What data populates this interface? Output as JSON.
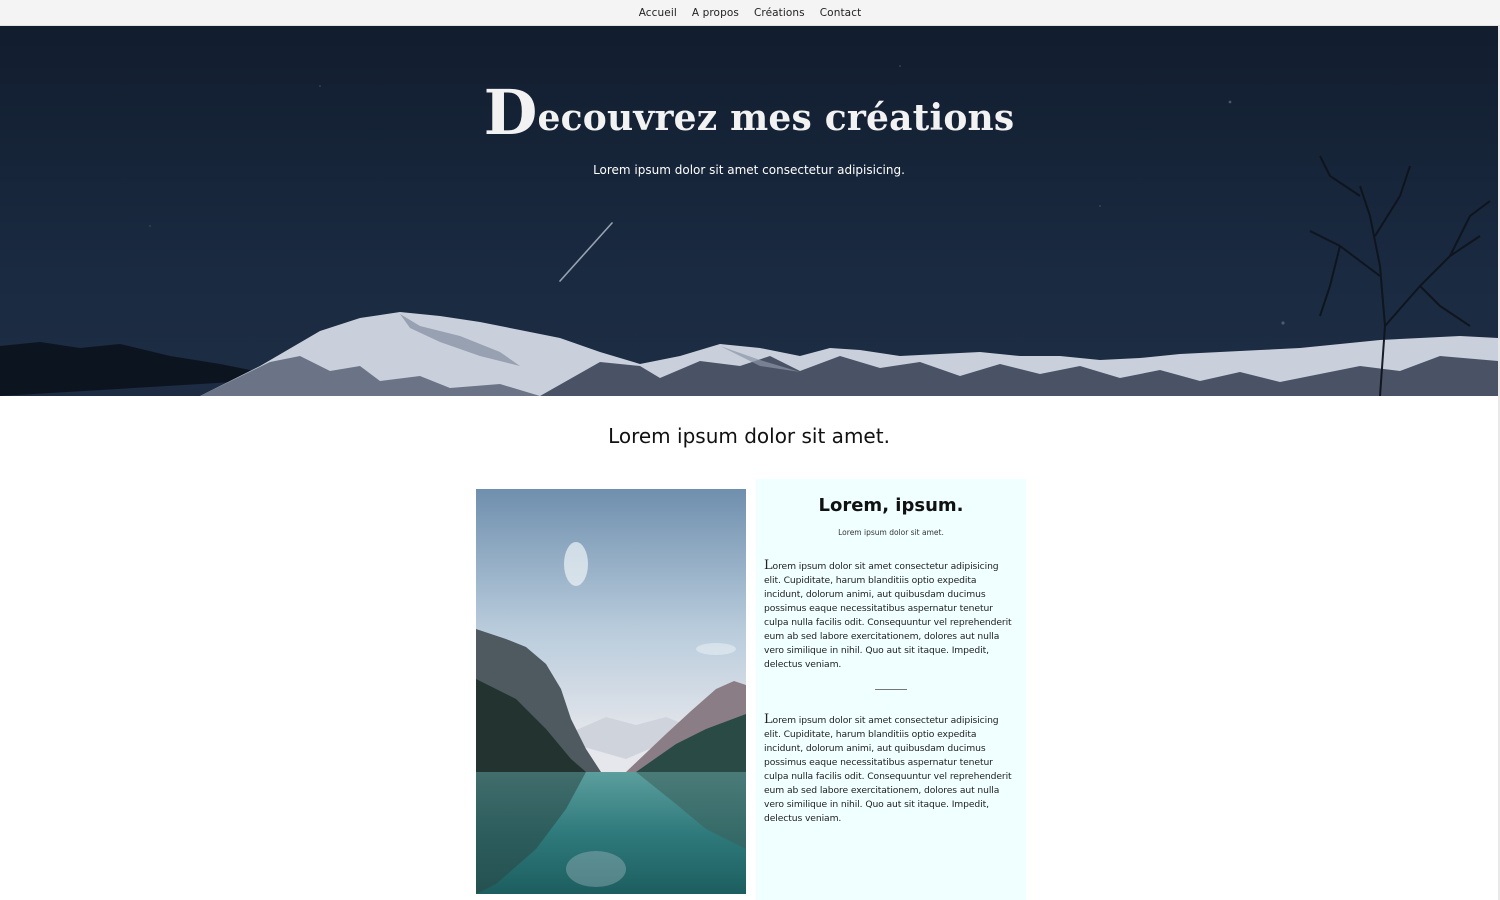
{
  "nav": {
    "items": [
      {
        "label": "Accueil"
      },
      {
        "label": "A propos"
      },
      {
        "label": "Créations"
      },
      {
        "label": "Contact"
      }
    ]
  },
  "hero": {
    "title_cap": "D",
    "title_rest": "ecouvrez mes créations",
    "subtitle": "Lorem ipsum dolor sit amet consectetur adipisicing."
  },
  "section": {
    "title": "Lorem ipsum dolor sit amet."
  },
  "card": {
    "title": "Lorem, ipsum.",
    "subtitle": "Lorem ipsum dolor sit amet.",
    "paragraph1_cap": "L",
    "paragraph1_rest": "orem ipsum dolor sit amet consectetur adipisicing elit. Cupiditate, harum blanditiis optio expedita incidunt, dolorum animi, aut quibusdam ducimus possimus eaque necessitatibus aspernatur tenetur culpa nulla facilis odit. Consequuntur vel reprehenderit eum ab sed labore exercitationem, dolores aut nulla vero similique in nihil. Quo aut sit itaque. Impedit, delectus veniam.",
    "paragraph2_cap": "L",
    "paragraph2_rest": "orem ipsum dolor sit amet consectetur adipisicing elit. Cupiditate, harum blanditiis optio expedita incidunt, dolorum animi, aut quibusdam ducimus possimus eaque necessitatibus aspernatur tenetur culpa nulla facilis odit. Consequuntur vel reprehenderit eum ab sed labore exercitationem, dolores aut nulla vero similique in nihil. Quo aut sit itaque. Impedit, delectus veniam."
  },
  "colors": {
    "nav_bg": "#f4f4f4",
    "hero_sky": "#17263b",
    "card_bg": "#f0ffff"
  }
}
